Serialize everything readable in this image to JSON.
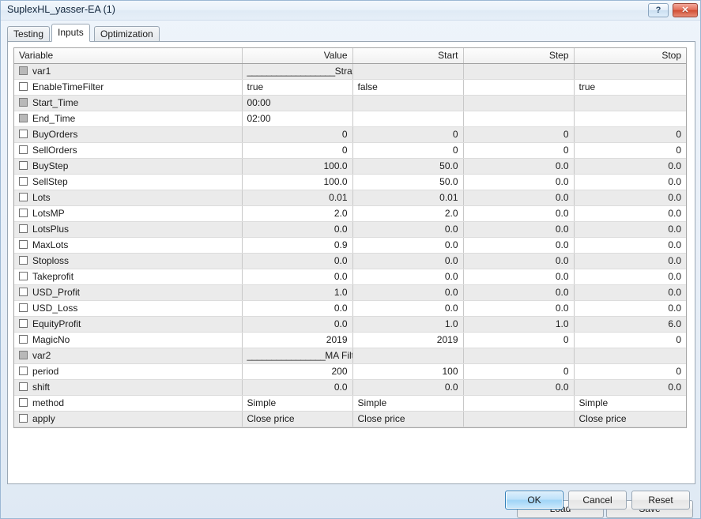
{
  "window": {
    "title": "SuplexHL_yasser-EA (1)",
    "help_label": "?",
    "close_label": "✕"
  },
  "tabs": [
    {
      "label": "Testing",
      "active": false
    },
    {
      "label": "Inputs",
      "active": true
    },
    {
      "label": "Optimization",
      "active": false
    }
  ],
  "grid": {
    "headers": {
      "variable": "Variable",
      "value": "Value",
      "start": "Start",
      "step": "Step",
      "stop": "Stop"
    },
    "rows": [
      {
        "name": "var1",
        "checkbox": "disabled",
        "separator": true,
        "sep_underline": "__________________",
        "sep_text": "Strategy Settings",
        "value": "",
        "start": "",
        "step": "",
        "stop": "",
        "align": "num"
      },
      {
        "name": "EnableTimeFilter",
        "checkbox": "enabled",
        "value": "true",
        "start": "false",
        "step": "",
        "stop": "true",
        "align": "txt"
      },
      {
        "name": "Start_Time",
        "checkbox": "disabled",
        "value": "00:00",
        "start": "",
        "step": "",
        "stop": "",
        "align": "txt"
      },
      {
        "name": "End_Time",
        "checkbox": "disabled",
        "value": "02:00",
        "start": "",
        "step": "",
        "stop": "",
        "align": "txt"
      },
      {
        "name": "BuyOrders",
        "checkbox": "enabled",
        "value": "0",
        "start": "0",
        "step": "0",
        "stop": "0",
        "align": "num"
      },
      {
        "name": "SellOrders",
        "checkbox": "enabled",
        "value": "0",
        "start": "0",
        "step": "0",
        "stop": "0",
        "align": "num"
      },
      {
        "name": "BuyStep",
        "checkbox": "enabled",
        "value": "100.0",
        "start": "50.0",
        "step": "0.0",
        "stop": "0.0",
        "align": "num"
      },
      {
        "name": "SellStep",
        "checkbox": "enabled",
        "value": "100.0",
        "start": "50.0",
        "step": "0.0",
        "stop": "0.0",
        "align": "num"
      },
      {
        "name": "Lots",
        "checkbox": "enabled",
        "value": "0.01",
        "start": "0.01",
        "step": "0.0",
        "stop": "0.0",
        "align": "num"
      },
      {
        "name": "LotsMP",
        "checkbox": "enabled",
        "value": "2.0",
        "start": "2.0",
        "step": "0.0",
        "stop": "0.0",
        "align": "num"
      },
      {
        "name": "LotsPlus",
        "checkbox": "enabled",
        "value": "0.0",
        "start": "0.0",
        "step": "0.0",
        "stop": "0.0",
        "align": "num"
      },
      {
        "name": "MaxLots",
        "checkbox": "enabled",
        "value": "0.9",
        "start": "0.0",
        "step": "0.0",
        "stop": "0.0",
        "align": "num"
      },
      {
        "name": "Stoploss",
        "checkbox": "enabled",
        "value": "0.0",
        "start": "0.0",
        "step": "0.0",
        "stop": "0.0",
        "align": "num"
      },
      {
        "name": "Takeprofit",
        "checkbox": "enabled",
        "value": "0.0",
        "start": "0.0",
        "step": "0.0",
        "stop": "0.0",
        "align": "num"
      },
      {
        "name": "USD_Profit",
        "checkbox": "enabled",
        "value": "1.0",
        "start": "0.0",
        "step": "0.0",
        "stop": "0.0",
        "align": "num"
      },
      {
        "name": "USD_Loss",
        "checkbox": "enabled",
        "value": "0.0",
        "start": "0.0",
        "step": "0.0",
        "stop": "0.0",
        "align": "num"
      },
      {
        "name": "EquityProfit",
        "checkbox": "enabled",
        "value": "0.0",
        "start": "1.0",
        "step": "1.0",
        "stop": "6.0",
        "align": "num"
      },
      {
        "name": "MagicNo",
        "checkbox": "enabled",
        "value": "2019",
        "start": "2019",
        "step": "0",
        "stop": "0",
        "align": "num"
      },
      {
        "name": "var2",
        "checkbox": "disabled",
        "separator": true,
        "sep_underline": "________________",
        "sep_text": "MA Filter Settings",
        "value": "",
        "start": "",
        "step": "",
        "stop": "",
        "align": "num"
      },
      {
        "name": "period",
        "checkbox": "enabled",
        "value": "200",
        "start": "100",
        "step": "0",
        "stop": "0",
        "align": "num"
      },
      {
        "name": "shift",
        "checkbox": "enabled",
        "value": "0.0",
        "start": "0.0",
        "step": "0.0",
        "stop": "0.0",
        "align": "num"
      },
      {
        "name": "method",
        "checkbox": "enabled",
        "value": "Simple",
        "start": "Simple",
        "step": "",
        "stop": "Simple",
        "align": "txt"
      },
      {
        "name": "apply",
        "checkbox": "enabled",
        "value": "Close price",
        "start": "Close price",
        "step": "",
        "stop": "Close price",
        "align": "txt"
      }
    ]
  },
  "actions": {
    "load": "Load",
    "save": "Save",
    "ok": "OK",
    "cancel": "Cancel",
    "reset": "Reset"
  },
  "colors": {
    "accent": "#9fd4f6",
    "close": "#d14e35",
    "row_alt": "#ebebeb"
  }
}
